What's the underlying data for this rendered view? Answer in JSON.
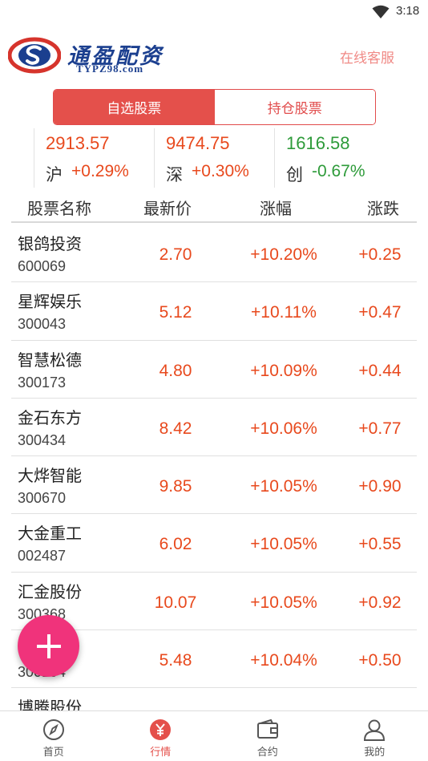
{
  "status_bar": {
    "time": "3:18",
    "wifi_icon": "wifi-icon"
  },
  "header": {
    "logo_name": "通盈配资",
    "logo_domain": "TYPZ98.com",
    "customer_service": "在线客服"
  },
  "tabs": [
    {
      "label": "自选股票",
      "active": true
    },
    {
      "label": "持仓股票",
      "active": false
    }
  ],
  "indices": [
    {
      "value": "2913.57",
      "name": "沪",
      "change": "+0.29%",
      "direction": "up"
    },
    {
      "value": "9474.75",
      "name": "深",
      "change": "+0.30%",
      "direction": "up"
    },
    {
      "value": "1616.58",
      "name": "创",
      "change": "-0.67%",
      "direction": "down"
    }
  ],
  "table": {
    "headers": [
      "股票名称",
      "最新价",
      "涨幅",
      "涨跌"
    ],
    "rows": [
      {
        "name": "银鸽投资",
        "code": "600069",
        "price": "2.70",
        "pct": "+10.20%",
        "change": "+0.25"
      },
      {
        "name": "星辉娱乐",
        "code": "300043",
        "price": "5.12",
        "pct": "+10.11%",
        "change": "+0.47"
      },
      {
        "name": "智慧松德",
        "code": "300173",
        "price": "4.80",
        "pct": "+10.09%",
        "change": "+0.44"
      },
      {
        "name": "金石东方",
        "code": "300434",
        "price": "8.42",
        "pct": "+10.06%",
        "change": "+0.77"
      },
      {
        "name": "大烨智能",
        "code": "300670",
        "price": "9.85",
        "pct": "+10.05%",
        "change": "+0.90"
      },
      {
        "name": "大金重工",
        "code": "002487",
        "price": "6.02",
        "pct": "+10.05%",
        "change": "+0.55"
      },
      {
        "name": "汇金股份",
        "code": "300368",
        "price": "10.07",
        "pct": "+10.05%",
        "change": "+0.92"
      },
      {
        "name": "",
        "code": "300194",
        "price": "5.48",
        "pct": "+10.04%",
        "change": "+0.50"
      },
      {
        "name": "博腾股份",
        "code": "",
        "price": "",
        "pct": "",
        "change": ""
      }
    ]
  },
  "fab": {
    "icon": "plus-icon"
  },
  "bottom_nav": [
    {
      "label": "首页",
      "icon": "compass-icon",
      "active": false
    },
    {
      "label": "行情",
      "icon": "yen-icon",
      "active": true
    },
    {
      "label": "合约",
      "icon": "wallet-icon",
      "active": false
    },
    {
      "label": "我的",
      "icon": "user-icon",
      "active": false
    }
  ],
  "colors": {
    "accent": "#e4504b",
    "up": "#e8491d",
    "down": "#2e9b3a",
    "fab": "#f0337b",
    "brand": "#1b3f8f"
  }
}
